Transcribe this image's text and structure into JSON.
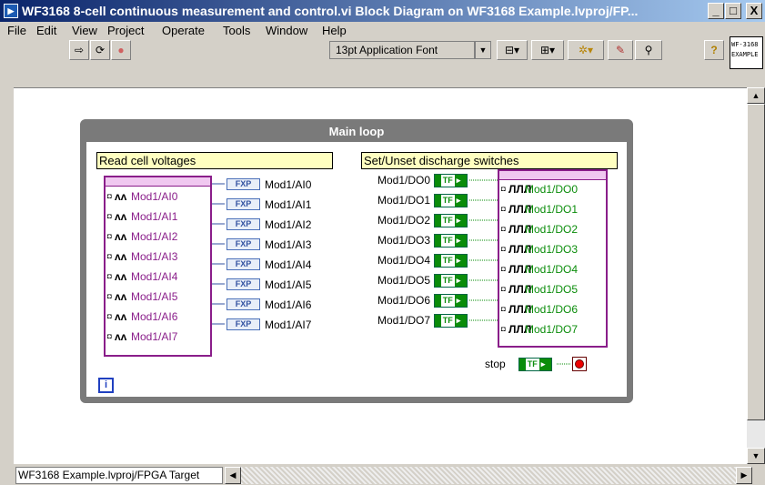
{
  "window": {
    "title": "WF3168 8-cell continuous measurement and control.vi Block Diagram on WF3168 Example.lvproj/FP...",
    "min_label": "_",
    "max_label": "□",
    "close_label": "X"
  },
  "menu": [
    "File",
    "Edit",
    "View",
    "Project",
    "Operate",
    "Tools",
    "Window",
    "Help"
  ],
  "toolbar": {
    "font_label": "13pt Application Font",
    "help_label": "?"
  },
  "context_help": {
    "line1": "WF-3168",
    "line2": "EXAMPLE"
  },
  "diagram": {
    "loop_title": "Main loop",
    "read_note": "Read cell voltages",
    "set_note": "Set/Unset discharge switches",
    "ai_channels": [
      "Mod1/AI0",
      "Mod1/AI1",
      "Mod1/AI2",
      "Mod1/AI3",
      "Mod1/AI4",
      "Mod1/AI5",
      "Mod1/AI6",
      "Mod1/AI7"
    ],
    "ai_symbol": "ʌʌ",
    "ai_indicators": [
      "Mod1/AI0",
      "Mod1/AI1",
      "Mod1/AI2",
      "Mod1/AI3",
      "Mod1/AI4",
      "Mod1/AI5",
      "Mod1/AI6",
      "Mod1/AI7"
    ],
    "fxp_label": "FXP",
    "do_controls": [
      "Mod1/DO0",
      "Mod1/DO1",
      "Mod1/DO2",
      "Mod1/DO3",
      "Mod1/DO4",
      "Mod1/DO5",
      "Mod1/DO6",
      "Mod1/DO7"
    ],
    "do_channels": [
      "Mod1/DO0",
      "Mod1/DO1",
      "Mod1/DO2",
      "Mod1/DO3",
      "Mod1/DO4",
      "Mod1/DO5",
      "Mod1/DO6",
      "Mod1/DO7"
    ],
    "do_symbol": "ЛЛЛ",
    "tf_label": "TF",
    "stop_label": "stop",
    "iteration_label": "i"
  },
  "status": {
    "target": "WF3168 Example.lvproj/FPGA Target"
  },
  "colors": {
    "ai_purple": "#8a1e8a",
    "do_green": "#0a8c0a",
    "loop_gray": "#7a7a7a",
    "note_yellow": "#ffffc0"
  }
}
